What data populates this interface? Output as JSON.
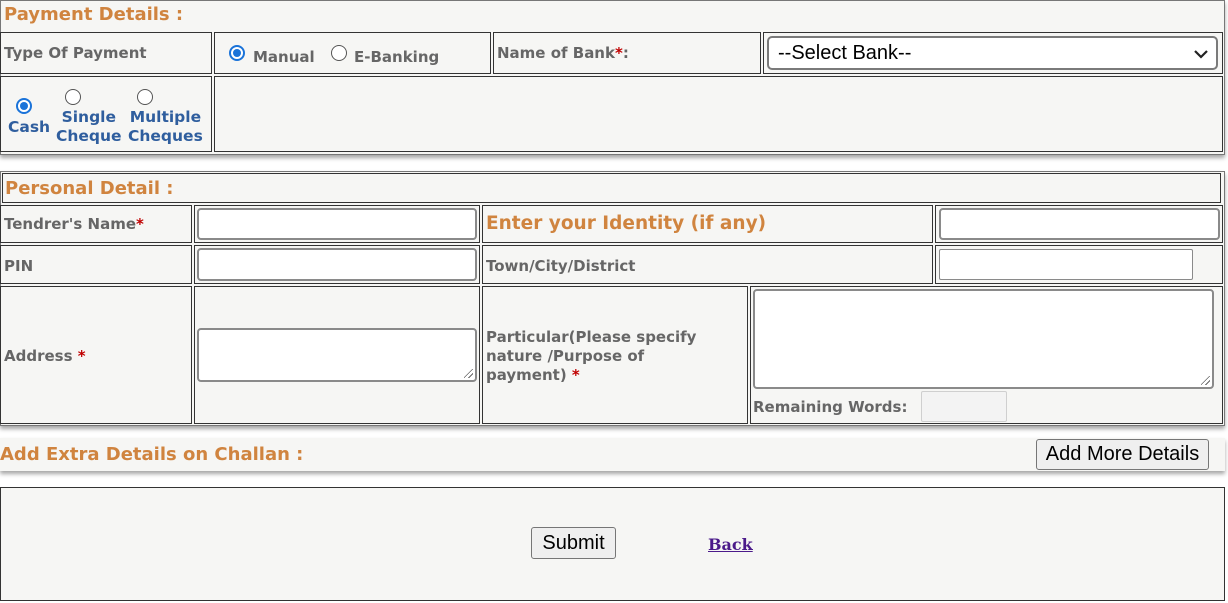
{
  "payment": {
    "title": "Payment Details :",
    "type_label": "Type Of Payment",
    "options": {
      "manual": "Manual",
      "ebanking": "E-Banking",
      "selected": "Manual"
    },
    "bank_label": "Name of Bank",
    "bank_select": "--Select Bank--",
    "mode": {
      "cash": "Cash",
      "single": [
        "Single",
        "Cheque"
      ],
      "multiple": [
        "Multiple",
        "Cheques"
      ],
      "selected": "Cash"
    }
  },
  "personal": {
    "title": "Personal Detail :",
    "tendrer_label": "Tendrer's Name",
    "identity_label": "Enter your Identity (if any)",
    "pin_label": "PIN",
    "town_label": "Town/City/District",
    "address_label": "Address",
    "particular_label": [
      "Particular(Please specify",
      "nature /Purpose of",
      "payment)"
    ],
    "remaining_label": "Remaining Words:",
    "required_mark": "*"
  },
  "extra": {
    "title": "Add Extra Details on Challan :",
    "button": "Add More Details"
  },
  "footer": {
    "submit": "Submit",
    "back": "Back"
  },
  "colors": {
    "section_title": "#d0843f",
    "required": "#c00000",
    "radio_accent": "#1a73d9",
    "mode_label": "#2f5e9e",
    "link": "#4b1a8a"
  }
}
